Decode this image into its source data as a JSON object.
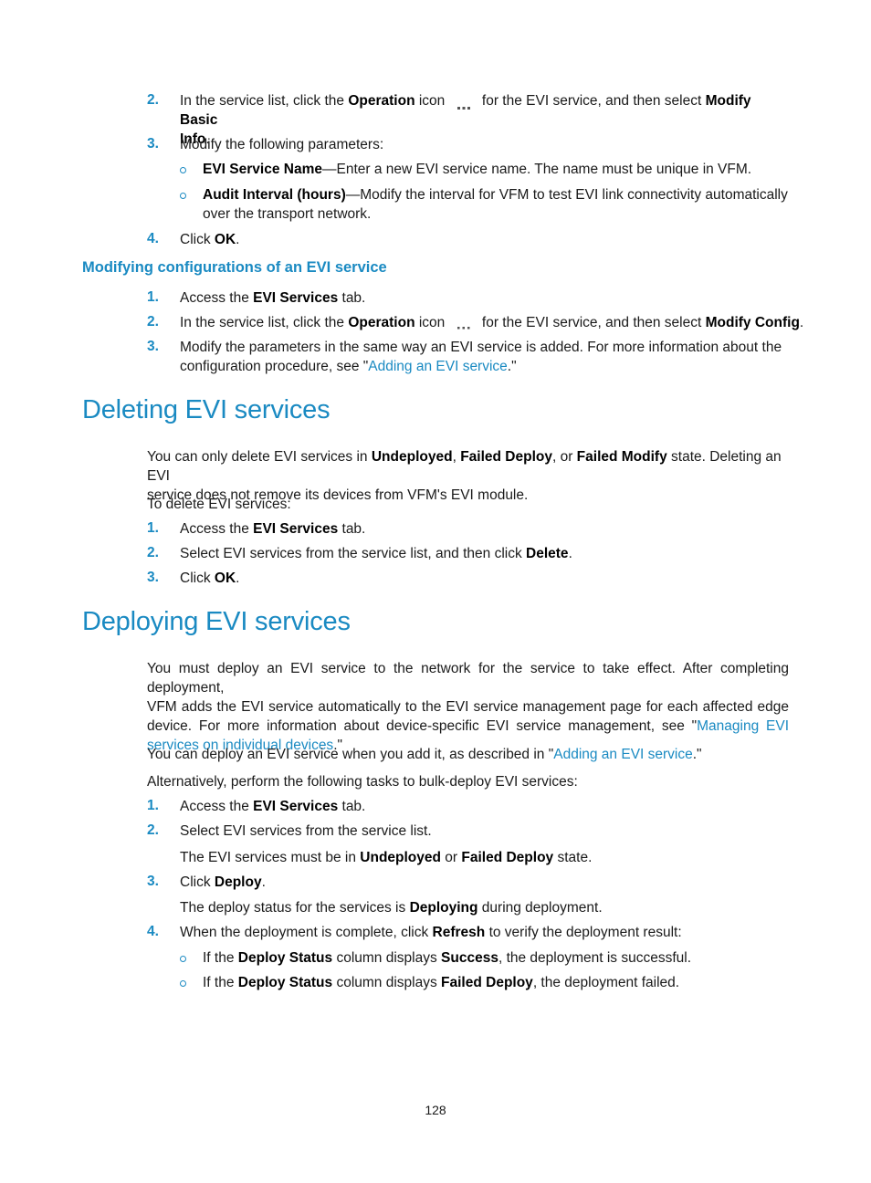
{
  "section1": {
    "steps": [
      {
        "num": "2.",
        "pre": "In the service list, click the ",
        "b1": "Operation",
        "mid": " icon ",
        "post": " for the EVI service, and then select ",
        "b2": "Modify Basic",
        "line2b": "Info",
        "line2end": "."
      },
      {
        "num": "3.",
        "text": "Modify the following parameters:"
      },
      {
        "num": "4.",
        "pre": "Click ",
        "b": "OK",
        "post": "."
      }
    ],
    "bullets": [
      {
        "b": "EVI Service Name",
        "text": "—Enter a new EVI service name. The name must be unique in VFM."
      },
      {
        "b": "Audit Interval (hours)",
        "text": "—Modify the interval for VFM to test EVI link connectivity automatically",
        "line2": "over the transport network."
      }
    ]
  },
  "modify_config": {
    "heading": "Modifying configurations of an EVI service",
    "steps": [
      {
        "num": "1.",
        "pre": "Access the ",
        "b": "EVI Services",
        "post": " tab."
      },
      {
        "num": "2.",
        "pre": "In the service list, click the ",
        "b1": "Operation",
        "mid": " icon ",
        "post": " for the EVI service, and then select ",
        "b2": "Modify Config",
        "end": "."
      },
      {
        "num": "3.",
        "line1": "Modify the parameters in the same way an EVI service is added. For more information about the",
        "line2pre": "configuration procedure, see \"",
        "link": "Adding an EVI service",
        "line2post": ".\""
      }
    ]
  },
  "deleting": {
    "heading": "Deleting EVI services",
    "intro": {
      "p1": "You can only delete EVI services in ",
      "b1": "Undeployed",
      "s1": ", ",
      "b2": "Failed Deploy",
      "s2": ", or ",
      "b3": "Failed Modify",
      "s3": " state. Deleting an EVI",
      "line2": "service does not remove its devices from VFM's EVI module."
    },
    "lead": "To delete EVI services:",
    "steps": [
      {
        "num": "1.",
        "pre": "Access the ",
        "b": "EVI Services",
        "post": " tab."
      },
      {
        "num": "2.",
        "pre": "Select EVI services from the service list, and then click ",
        "b": "Delete",
        "post": "."
      },
      {
        "num": "3.",
        "pre": "Click ",
        "b": "OK",
        "post": "."
      }
    ]
  },
  "deploying": {
    "heading": "Deploying EVI services",
    "intro": {
      "l1": "You must deploy an EVI service to the network for the service to take effect. After completing deployment,",
      "l2": "VFM adds the EVI service automatically to the EVI service management page for each affected edge",
      "l3pre": "device. For more information about device-specific EVI service management, see \"",
      "link_a": "Managing EVI",
      "link_b": "services on individual devices",
      "l4post": ".\""
    },
    "p2": {
      "pre": "You can deploy an EVI service when you add it, as described in \"",
      "link": "Adding an EVI service",
      "post": ".\""
    },
    "p3": "Alternatively, perform the following tasks to bulk-deploy EVI services:",
    "steps": [
      {
        "num": "1.",
        "pre": "Access the ",
        "b": "EVI Services",
        "post": " tab."
      },
      {
        "num": "2.",
        "text": "Select EVI services from the service list.",
        "note_pre": "The EVI services must be in ",
        "note_b1": "Undeployed",
        "note_mid": " or ",
        "note_b2": "Failed Deploy",
        "note_post": " state."
      },
      {
        "num": "3.",
        "pre": "Click ",
        "b": "Deploy",
        "post": ".",
        "note_pre": "The deploy status for the services is ",
        "note_b": "Deploying",
        "note_post": " during deployment."
      },
      {
        "num": "4.",
        "pre": "When the deployment is complete, click ",
        "b": "Refresh",
        "post": " to verify the deployment result:"
      }
    ],
    "bullets": [
      {
        "pre": "If the ",
        "b1": "Deploy Status",
        "mid": " column displays ",
        "b2": "Success",
        "post": ", the deployment is successful."
      },
      {
        "pre": "If the ",
        "b1": "Deploy Status",
        "mid": " column displays ",
        "b2": "Failed Deploy",
        "post": ", the deployment failed."
      }
    ]
  },
  "footer": {
    "page_number": "128"
  },
  "colors": {
    "accent": "#1a8ac2",
    "text": "#1a1a1a"
  }
}
